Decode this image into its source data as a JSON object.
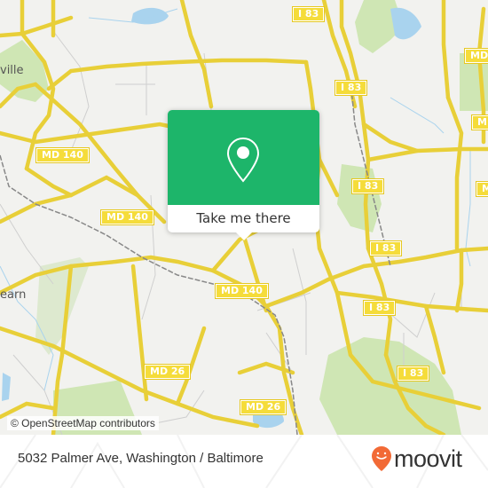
{
  "map": {
    "attribution": "© OpenStreetMap contributors",
    "place_labels": [
      {
        "id": "pikesville",
        "text": "ville"
      },
      {
        "id": "woodlawn",
        "text": "earn"
      }
    ],
    "road_shields": [
      {
        "id": "md140-1",
        "text": "MD 140"
      },
      {
        "id": "md140-2",
        "text": "MD 140"
      },
      {
        "id": "md140-3",
        "text": "MD 140"
      },
      {
        "id": "md26-1",
        "text": "MD 26"
      },
      {
        "id": "md26-2",
        "text": "MD 26"
      },
      {
        "id": "i83-1",
        "text": "I 83"
      },
      {
        "id": "i83-2",
        "text": "I 83"
      },
      {
        "id": "i83-3",
        "text": "I 83"
      },
      {
        "id": "i83-4",
        "text": "I 83"
      },
      {
        "id": "i83-5",
        "text": "I 83"
      },
      {
        "id": "i83-6",
        "text": "I 83"
      },
      {
        "id": "i83-7",
        "text": "I 83"
      },
      {
        "id": "md-1",
        "text": "MD"
      },
      {
        "id": "md-2",
        "text": "MD"
      },
      {
        "id": "md-3",
        "text": "M"
      }
    ],
    "colors": {
      "background": "#f2f2ef",
      "road": "#f5dc3a",
      "park": "#cfe6b4",
      "water": "#a9d3ee",
      "rail": "#888888"
    }
  },
  "popup": {
    "icon": "map-pin-icon",
    "button_label": "Take me there",
    "accent_color": "#1db56a"
  },
  "footer": {
    "address": "5032 Palmer Ave, Washington / Baltimore",
    "brand": "moovit",
    "brand_color": "#f26a36"
  }
}
